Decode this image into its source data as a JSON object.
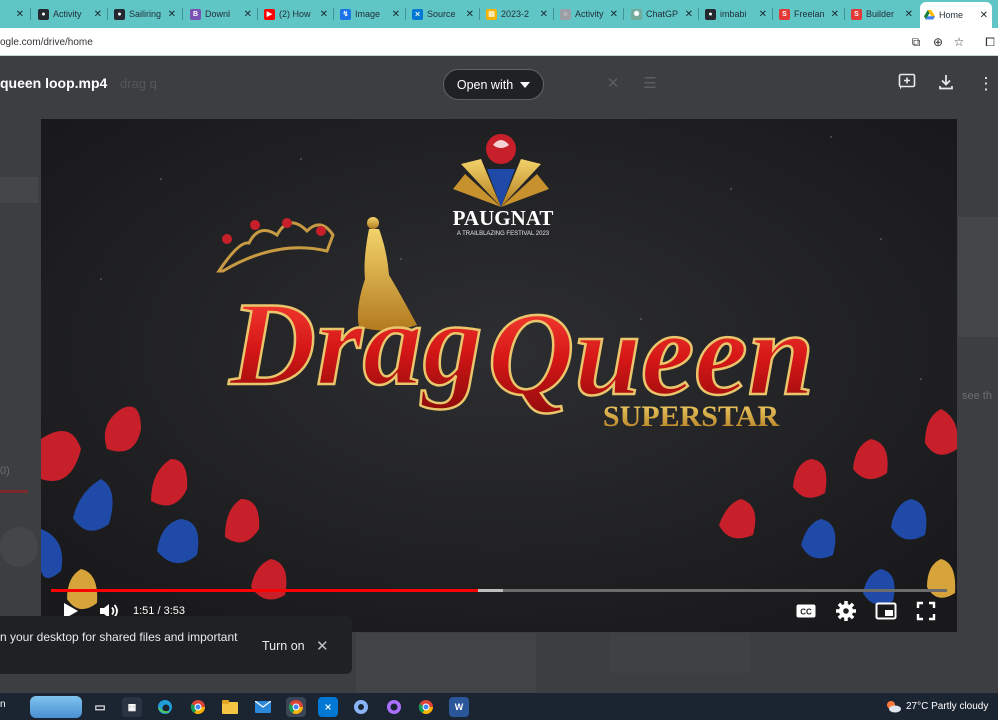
{
  "browser": {
    "tabs": [
      {
        "label": "",
        "fav_color": "#9aa0a6",
        "fav_glyph": ""
      },
      {
        "label": "Activity",
        "fav_color": "#24292f",
        "fav_glyph": "◉"
      },
      {
        "label": "Sailiring",
        "fav_color": "#24292f",
        "fav_glyph": "◉"
      },
      {
        "label": "Downl",
        "fav_color": "#7952b3",
        "fav_glyph": "B"
      },
      {
        "label": "(2) How",
        "fav_color": "#ff0000",
        "fav_glyph": "▶"
      },
      {
        "label": "Image",
        "fav_color": "#1a73e8",
        "fav_glyph": "↯"
      },
      {
        "label": "Source",
        "fav_color": "#0078d4",
        "fav_glyph": "⨯"
      },
      {
        "label": "2023-2",
        "fav_color": "#fbbc04",
        "fav_glyph": "▤"
      },
      {
        "label": "Activity",
        "fav_color": "#9aa0a6",
        "fav_glyph": "○"
      },
      {
        "label": "ChatGP",
        "fav_color": "#74aa9c",
        "fav_glyph": "✺"
      },
      {
        "label": "imbabi",
        "fav_color": "#24292f",
        "fav_glyph": "◉"
      },
      {
        "label": "Freelan",
        "fav_color": "#e53935",
        "fav_glyph": "S"
      },
      {
        "label": "Builder",
        "fav_color": "#e53935",
        "fav_glyph": "S"
      },
      {
        "label": "Home",
        "fav_color": "#1a73e8",
        "fav_glyph": "▲"
      }
    ],
    "url": "ogle.com/drive/home"
  },
  "viewer": {
    "filename": "queen loop.mp4",
    "search_ghost": "drag q",
    "open_with_label": "Open with"
  },
  "video": {
    "logo_title": "PAUGNAT",
    "logo_subtitle": "A TRAILBLAZING FESTIVAL 2023",
    "headline_1": "Drag",
    "headline_2": "Queen",
    "tagline": "SUPERSTAR",
    "time_display": "1:51 / 3:53",
    "played_fraction": 0.477,
    "loaded_fraction": 0.505
  },
  "toast": {
    "message": "n your desktop for shared files and important",
    "action_label": "Turn on",
    "close_glyph": "✕"
  },
  "background_fragments": {
    "left_number": "0)",
    "right_text": "see th"
  },
  "taskbar": {
    "weather": "27°C  Partly cloudy",
    "start_fragment": "n"
  },
  "colors": {
    "tab_strip": "#5fc5c5",
    "progress_played": "#ff0000",
    "headline_red": "#d81e1e",
    "gold": "#d9a63a"
  }
}
